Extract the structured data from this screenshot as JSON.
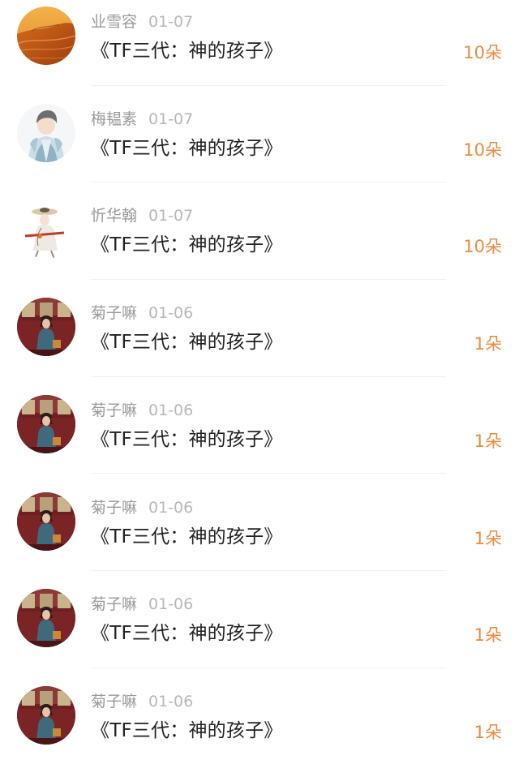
{
  "gifts": [
    {
      "user": "业雪容",
      "date": "01-07",
      "title": "《TF三代：神的孩子》",
      "amount": "10朵",
      "avatar": "desert-avatar"
    },
    {
      "user": "梅韫素",
      "date": "01-07",
      "title": "《TF三代：神的孩子》",
      "amount": "10朵",
      "avatar": "anime-jacket-avatar"
    },
    {
      "user": "忻华翰",
      "date": "01-07",
      "title": "《TF三代：神的孩子》",
      "amount": "10朵",
      "avatar": "ink-figure-avatar"
    },
    {
      "user": "菊子嘛",
      "date": "01-06",
      "title": "《TF三代：神的孩子》",
      "amount": "1朵",
      "avatar": "train-girl-avatar"
    },
    {
      "user": "菊子嘛",
      "date": "01-06",
      "title": "《TF三代：神的孩子》",
      "amount": "1朵",
      "avatar": "train-girl-avatar"
    },
    {
      "user": "菊子嘛",
      "date": "01-06",
      "title": "《TF三代：神的孩子》",
      "amount": "1朵",
      "avatar": "train-girl-avatar"
    },
    {
      "user": "菊子嘛",
      "date": "01-06",
      "title": "《TF三代：神的孩子》",
      "amount": "1朵",
      "avatar": "train-girl-avatar"
    },
    {
      "user": "菊子嘛",
      "date": "01-06",
      "title": "《TF三代：神的孩子》",
      "amount": "1朵",
      "avatar": "train-girl-avatar"
    }
  ],
  "colors": {
    "amount": "#ec8b3f",
    "title": "#222222",
    "meta": "#9a9a9a"
  }
}
